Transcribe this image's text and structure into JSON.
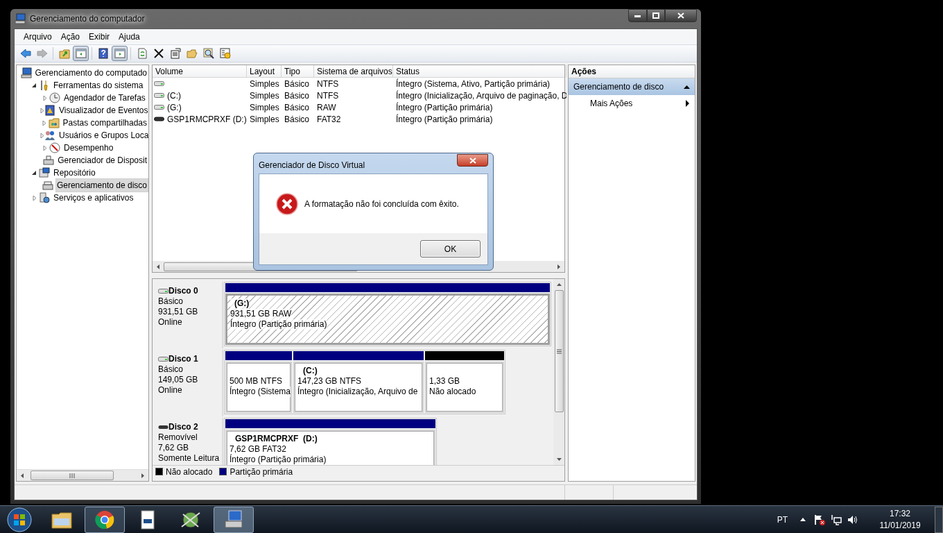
{
  "window": {
    "title": "Gerenciamento do computador"
  },
  "menu": [
    "Arquivo",
    "Ação",
    "Exibir",
    "Ajuda"
  ],
  "toolbar": [
    {
      "pressed": false,
      "disabled": false
    },
    {
      "pressed": false,
      "disabled": true
    },
    {
      "pressed": false,
      "disabled": false
    },
    {
      "pressed": true,
      "disabled": false
    },
    {
      "pressed": false,
      "disabled": false
    },
    {
      "pressed": true,
      "disabled": false
    },
    {
      "pressed": false,
      "disabled": false
    },
    {
      "pressed": false,
      "disabled": false
    },
    {
      "pressed": false,
      "disabled": false
    },
    {
      "pressed": false,
      "disabled": false
    },
    {
      "pressed": false,
      "disabled": false
    },
    {
      "pressed": false,
      "disabled": false
    }
  ],
  "tree": [
    {
      "label": "Gerenciamento do computado",
      "selected": false,
      "children": [
        {
          "label": "Ferramentas do sistema",
          "expanded": true,
          "selected": false,
          "children": [
            {
              "label": "Agendador de Tarefas",
              "expanded": false,
              "selected": false
            },
            {
              "label": "Visualizador de Eventos",
              "expanded": false,
              "selected": false
            },
            {
              "label": "Pastas compartilhadas",
              "expanded": false,
              "selected": false
            },
            {
              "label": "Usuários e Grupos Loca",
              "expanded": false,
              "selected": false
            },
            {
              "label": "Desempenho",
              "expanded": false,
              "selected": false
            },
            {
              "label": "Gerenciador de Disposit",
              "selected": false
            }
          ]
        },
        {
          "label": "Repositório",
          "expanded": true,
          "selected": false,
          "children": [
            {
              "label": "Gerenciamento de disco",
              "selected": true
            }
          ]
        },
        {
          "label": "Serviços e aplicativos",
          "expanded": false,
          "selected": false
        }
      ]
    }
  ],
  "volumes": {
    "columns": [
      "Volume",
      "Layout",
      "Tipo",
      "Sistema de arquivos",
      "Status"
    ],
    "rows": [
      {
        "kind": "fixed",
        "cells": [
          "",
          "Simples",
          "Básico",
          "NTFS",
          "Íntegro (Sistema, Ativo, Partição primária)"
        ]
      },
      {
        "kind": "fixed",
        "cells": [
          "(C:)",
          "Simples",
          "Básico",
          "NTFS",
          "Íntegro (Inicialização, Arquivo de paginação, D"
        ]
      },
      {
        "kind": "fixed",
        "cells": [
          "(G:)",
          "Simples",
          "Básico",
          "RAW",
          "Íntegro (Partição primária)"
        ]
      },
      {
        "kind": "removable",
        "cells": [
          "GSP1RMCPRXF (D:)",
          "Simples",
          "Básico",
          "FAT32",
          "Íntegro (Partição primária)"
        ]
      }
    ]
  },
  "disks": [
    {
      "kind": "fixed",
      "name": "Disco 0",
      "type": "Básico",
      "size": "931,51 GB",
      "state": "Online",
      "partitions": [
        {
          "kind": "primary",
          "selected": true,
          "label": "(G:)",
          "size": "931,51 GB RAW",
          "status": "Íntegro (Partição primária)"
        }
      ]
    },
    {
      "kind": "fixed",
      "name": "Disco 1",
      "type": "Básico",
      "size": "149,05 GB",
      "state": "Online",
      "partitions": [
        {
          "kind": "primary",
          "selected": false,
          "size": "500 MB NTFS",
          "status": "Íntegro (Sistema"
        },
        {
          "kind": "primary",
          "selected": false,
          "label": "(C:)",
          "size": "147,23 GB NTFS",
          "status": "Íntegro (Inicialização, Arquivo de"
        },
        {
          "kind": "unallocated",
          "selected": false,
          "size": "1,33 GB",
          "status": "Não alocado"
        }
      ]
    },
    {
      "kind": "removable",
      "name": "Disco 2",
      "type": "Removível",
      "size": "7,62 GB",
      "state": "Somente Leitura",
      "partitions": [
        {
          "kind": "primary",
          "selected": false,
          "label": "GSP1RMCPRXF  (D:)",
          "size": "7,62 GB FAT32",
          "status": "Íntegro (Partição primária)"
        }
      ]
    }
  ],
  "legend": [
    {
      "label": "Não alocado",
      "color": "#000000"
    },
    {
      "label": "Partição primária",
      "color": "#000080"
    }
  ],
  "actions": {
    "title": "Ações",
    "section": "Gerenciamento de disco",
    "items": [
      "Mais Ações"
    ]
  },
  "dialog": {
    "title": "Gerenciador de Disco Virtual",
    "message": "A formatação não foi concluída com êxito.",
    "button": "OK"
  },
  "taskbar": {
    "apps": [
      {
        "running": false,
        "active": false
      },
      {
        "running": true,
        "active": false
      },
      {
        "running": false,
        "active": false
      },
      {
        "running": false,
        "active": false
      },
      {
        "running": true,
        "active": true
      }
    ],
    "language": "PT",
    "time": "17:32",
    "date": "11/01/2019"
  }
}
